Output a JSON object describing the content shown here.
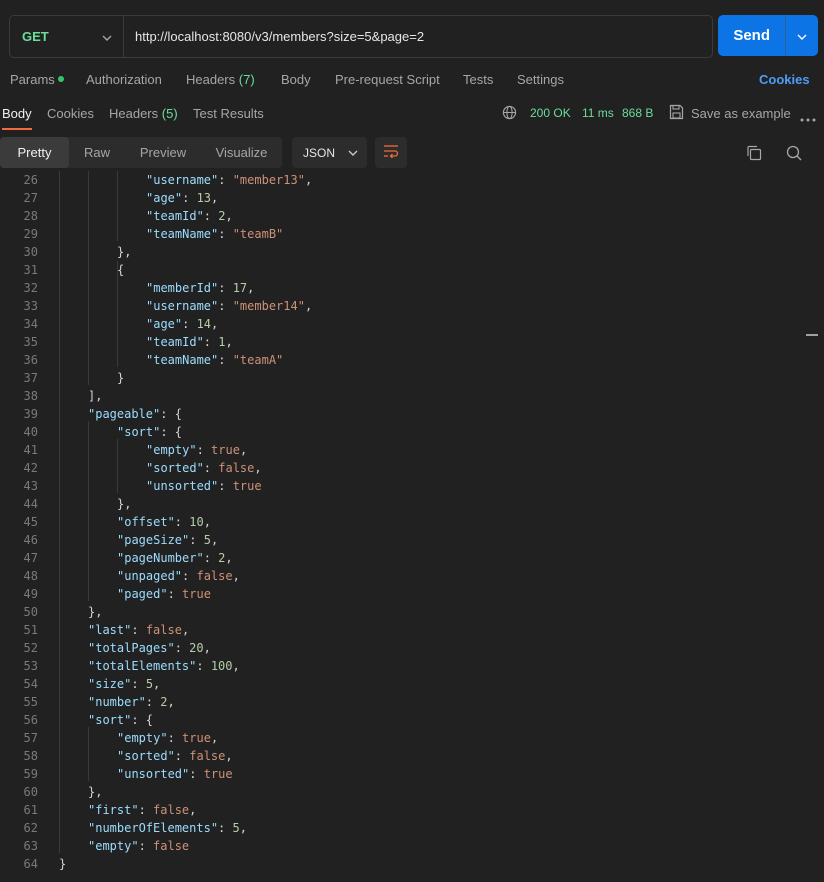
{
  "request": {
    "method": "GET",
    "url": "http://localhost:8080/v3/members?size=5&page=2",
    "send_label": "Send"
  },
  "request_tabs": {
    "params": "Params",
    "authorization": "Authorization",
    "headers": "Headers",
    "headers_count": "(7)",
    "body": "Body",
    "pre_request": "Pre-request Script",
    "tests": "Tests",
    "settings": "Settings",
    "cookies": "Cookies"
  },
  "response_tabs": {
    "body": "Body",
    "cookies": "Cookies",
    "headers": "Headers",
    "headers_count": "(5)",
    "test_results": "Test Results"
  },
  "response_meta": {
    "status": "200 OK",
    "time": "11 ms",
    "size": "868 B",
    "save_example": "Save as example"
  },
  "view_modes": [
    "Pretty",
    "Raw",
    "Preview",
    "Visualize"
  ],
  "format": "JSON",
  "colors": {
    "accent_blue": "#0c74e4",
    "status_green": "#6bdd9a",
    "active_tab_underline": "#f26b3a"
  },
  "code_lines": [
    {
      "n": "26",
      "indent": 4,
      "t": [
        [
          "key",
          "\"username\""
        ],
        [
          "pun",
          ": "
        ],
        [
          "str",
          "\"member13\""
        ],
        [
          "pun",
          ","
        ]
      ]
    },
    {
      "n": "27",
      "indent": 4,
      "t": [
        [
          "key",
          "\"age\""
        ],
        [
          "pun",
          ": "
        ],
        [
          "num",
          "13"
        ],
        [
          "pun",
          ","
        ]
      ]
    },
    {
      "n": "28",
      "indent": 4,
      "t": [
        [
          "key",
          "\"teamId\""
        ],
        [
          "pun",
          ": "
        ],
        [
          "num",
          "2"
        ],
        [
          "pun",
          ","
        ]
      ]
    },
    {
      "n": "29",
      "indent": 4,
      "t": [
        [
          "key",
          "\"teamName\""
        ],
        [
          "pun",
          ": "
        ],
        [
          "str",
          "\"teamB\""
        ]
      ]
    },
    {
      "n": "30",
      "indent": 3,
      "t": [
        [
          "pun",
          "},"
        ]
      ]
    },
    {
      "n": "31",
      "indent": 3,
      "t": [
        [
          "pun",
          "{"
        ]
      ]
    },
    {
      "n": "32",
      "indent": 4,
      "t": [
        [
          "key",
          "\"memberId\""
        ],
        [
          "pun",
          ": "
        ],
        [
          "num",
          "17"
        ],
        [
          "pun",
          ","
        ]
      ]
    },
    {
      "n": "33",
      "indent": 4,
      "t": [
        [
          "key",
          "\"username\""
        ],
        [
          "pun",
          ": "
        ],
        [
          "str",
          "\"member14\""
        ],
        [
          "pun",
          ","
        ]
      ]
    },
    {
      "n": "34",
      "indent": 4,
      "t": [
        [
          "key",
          "\"age\""
        ],
        [
          "pun",
          ": "
        ],
        [
          "num",
          "14"
        ],
        [
          "pun",
          ","
        ]
      ]
    },
    {
      "n": "35",
      "indent": 4,
      "t": [
        [
          "key",
          "\"teamId\""
        ],
        [
          "pun",
          ": "
        ],
        [
          "num",
          "1"
        ],
        [
          "pun",
          ","
        ]
      ]
    },
    {
      "n": "36",
      "indent": 4,
      "t": [
        [
          "key",
          "\"teamName\""
        ],
        [
          "pun",
          ": "
        ],
        [
          "str",
          "\"teamA\""
        ]
      ]
    },
    {
      "n": "37",
      "indent": 3,
      "t": [
        [
          "pun",
          "}"
        ]
      ]
    },
    {
      "n": "38",
      "indent": 2,
      "t": [
        [
          "pun",
          "],"
        ]
      ]
    },
    {
      "n": "39",
      "indent": 2,
      "t": [
        [
          "key",
          "\"pageable\""
        ],
        [
          "pun",
          ": {"
        ]
      ]
    },
    {
      "n": "40",
      "indent": 3,
      "t": [
        [
          "key",
          "\"sort\""
        ],
        [
          "pun",
          ": {"
        ]
      ]
    },
    {
      "n": "41",
      "indent": 4,
      "t": [
        [
          "key",
          "\"empty\""
        ],
        [
          "pun",
          ": "
        ],
        [
          "bool",
          "true"
        ],
        [
          "pun",
          ","
        ]
      ]
    },
    {
      "n": "42",
      "indent": 4,
      "t": [
        [
          "key",
          "\"sorted\""
        ],
        [
          "pun",
          ": "
        ],
        [
          "bool",
          "false"
        ],
        [
          "pun",
          ","
        ]
      ]
    },
    {
      "n": "43",
      "indent": 4,
      "t": [
        [
          "key",
          "\"unsorted\""
        ],
        [
          "pun",
          ": "
        ],
        [
          "bool",
          "true"
        ]
      ]
    },
    {
      "n": "44",
      "indent": 3,
      "t": [
        [
          "pun",
          "},"
        ]
      ]
    },
    {
      "n": "45",
      "indent": 3,
      "t": [
        [
          "key",
          "\"offset\""
        ],
        [
          "pun",
          ": "
        ],
        [
          "num",
          "10"
        ],
        [
          "pun",
          ","
        ]
      ]
    },
    {
      "n": "46",
      "indent": 3,
      "t": [
        [
          "key",
          "\"pageSize\""
        ],
        [
          "pun",
          ": "
        ],
        [
          "num",
          "5"
        ],
        [
          "pun",
          ","
        ]
      ]
    },
    {
      "n": "47",
      "indent": 3,
      "t": [
        [
          "key",
          "\"pageNumber\""
        ],
        [
          "pun",
          ": "
        ],
        [
          "num",
          "2"
        ],
        [
          "pun",
          ","
        ]
      ]
    },
    {
      "n": "48",
      "indent": 3,
      "t": [
        [
          "key",
          "\"unpaged\""
        ],
        [
          "pun",
          ": "
        ],
        [
          "bool",
          "false"
        ],
        [
          "pun",
          ","
        ]
      ]
    },
    {
      "n": "49",
      "indent": 3,
      "t": [
        [
          "key",
          "\"paged\""
        ],
        [
          "pun",
          ": "
        ],
        [
          "bool",
          "true"
        ]
      ]
    },
    {
      "n": "50",
      "indent": 2,
      "t": [
        [
          "pun",
          "},"
        ]
      ]
    },
    {
      "n": "51",
      "indent": 2,
      "t": [
        [
          "key",
          "\"last\""
        ],
        [
          "pun",
          ": "
        ],
        [
          "bool",
          "false"
        ],
        [
          "pun",
          ","
        ]
      ]
    },
    {
      "n": "52",
      "indent": 2,
      "t": [
        [
          "key",
          "\"totalPages\""
        ],
        [
          "pun",
          ": "
        ],
        [
          "num",
          "20"
        ],
        [
          "pun",
          ","
        ]
      ]
    },
    {
      "n": "53",
      "indent": 2,
      "t": [
        [
          "key",
          "\"totalElements\""
        ],
        [
          "pun",
          ": "
        ],
        [
          "num",
          "100"
        ],
        [
          "pun",
          ","
        ]
      ]
    },
    {
      "n": "54",
      "indent": 2,
      "t": [
        [
          "key",
          "\"size\""
        ],
        [
          "pun",
          ": "
        ],
        [
          "num",
          "5"
        ],
        [
          "pun",
          ","
        ]
      ]
    },
    {
      "n": "55",
      "indent": 2,
      "t": [
        [
          "key",
          "\"number\""
        ],
        [
          "pun",
          ": "
        ],
        [
          "num",
          "2"
        ],
        [
          "pun",
          ","
        ]
      ]
    },
    {
      "n": "56",
      "indent": 2,
      "t": [
        [
          "key",
          "\"sort\""
        ],
        [
          "pun",
          ": {"
        ]
      ]
    },
    {
      "n": "57",
      "indent": 3,
      "t": [
        [
          "key",
          "\"empty\""
        ],
        [
          "pun",
          ": "
        ],
        [
          "bool",
          "true"
        ],
        [
          "pun",
          ","
        ]
      ]
    },
    {
      "n": "58",
      "indent": 3,
      "t": [
        [
          "key",
          "\"sorted\""
        ],
        [
          "pun",
          ": "
        ],
        [
          "bool",
          "false"
        ],
        [
          "pun",
          ","
        ]
      ]
    },
    {
      "n": "59",
      "indent": 3,
      "t": [
        [
          "key",
          "\"unsorted\""
        ],
        [
          "pun",
          ": "
        ],
        [
          "bool",
          "true"
        ]
      ]
    },
    {
      "n": "60",
      "indent": 2,
      "t": [
        [
          "pun",
          "},"
        ]
      ]
    },
    {
      "n": "61",
      "indent": 2,
      "t": [
        [
          "key",
          "\"first\""
        ],
        [
          "pun",
          ": "
        ],
        [
          "bool",
          "false"
        ],
        [
          "pun",
          ","
        ]
      ]
    },
    {
      "n": "62",
      "indent": 2,
      "t": [
        [
          "key",
          "\"numberOfElements\""
        ],
        [
          "pun",
          ": "
        ],
        [
          "num",
          "5"
        ],
        [
          "pun",
          ","
        ]
      ]
    },
    {
      "n": "63",
      "indent": 2,
      "t": [
        [
          "key",
          "\"empty\""
        ],
        [
          "pun",
          ": "
        ],
        [
          "bool",
          "false"
        ]
      ]
    },
    {
      "n": "64",
      "indent": 1,
      "t": [
        [
          "pun",
          "}"
        ]
      ]
    }
  ]
}
